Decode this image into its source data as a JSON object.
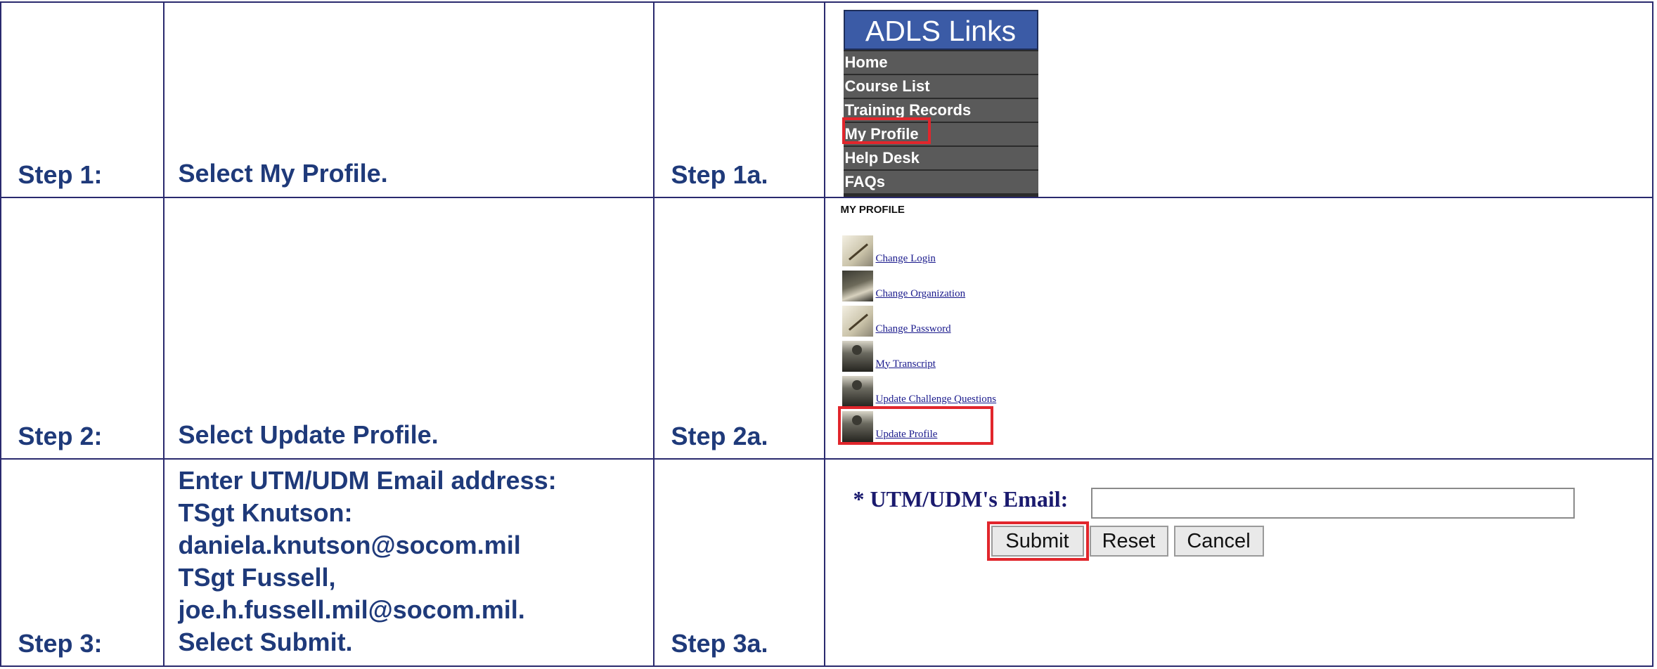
{
  "rows": [
    {
      "step_label": "Step 1:",
      "instruction": [
        "Select My Profile."
      ],
      "sub_label": "Step 1a."
    },
    {
      "step_label": "Step 2:",
      "instruction": [
        "Select Update Profile."
      ],
      "sub_label": "Step 2a."
    },
    {
      "step_label": "Step 3:",
      "instruction": [
        "Enter UTM/UDM Email address:",
        "TSgt Knutson:",
        "daniela.knutson@socom.mil",
        "TSgt Fussell,",
        "joe.h.fussell.mil@socom.mil.",
        "Select Submit."
      ],
      "sub_label": "Step 3a."
    }
  ],
  "adls_menu": {
    "title": "ADLS Links",
    "items": [
      "Home",
      "Course List",
      "Training Records",
      "My Profile",
      "Help Desk",
      "FAQs"
    ]
  },
  "my_profile": {
    "title": "MY PROFILE",
    "items": [
      {
        "label": "Change Login",
        "icon": "pen-icon"
      },
      {
        "label": "Change Organization",
        "icon": "book-icon"
      },
      {
        "label": "Change Password",
        "icon": "pen-icon"
      },
      {
        "label": "My Transcript",
        "icon": "person-icon"
      },
      {
        "label": "Update Challenge Questions",
        "icon": "person-icon"
      },
      {
        "label": "Update Profile",
        "icon": "person-icon"
      }
    ]
  },
  "email_form": {
    "label": "* UTM/UDM's Email:",
    "value": "",
    "buttons": {
      "submit": "Submit",
      "reset": "Reset",
      "cancel": "Cancel"
    }
  },
  "colors": {
    "text": "#1f3a7a",
    "border": "#2a2a6e",
    "highlight": "#e1262c",
    "menu_header": "#3b5ba6"
  }
}
